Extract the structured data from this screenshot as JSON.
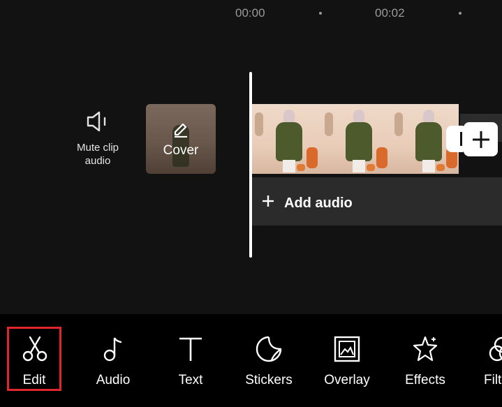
{
  "timeline": {
    "ruler": {
      "t0": "00:00",
      "t1": "00:02"
    },
    "mute_clip": {
      "label_line1": "Mute clip",
      "label_line2": "audio"
    },
    "cover": {
      "label": "Cover"
    },
    "add_audio": {
      "label": "Add audio"
    }
  },
  "toolbar": {
    "tools": [
      {
        "label": "Edit",
        "icon": "scissors-icon",
        "selected": true
      },
      {
        "label": "Audio",
        "icon": "music-note-icon"
      },
      {
        "label": "Text",
        "icon": "text-icon"
      },
      {
        "label": "Stickers",
        "icon": "sticker-icon"
      },
      {
        "label": "Overlay",
        "icon": "overlay-icon"
      },
      {
        "label": "Effects",
        "icon": "effects-star-icon"
      },
      {
        "label": "Filt",
        "icon": "filters-icon"
      }
    ]
  },
  "colors": {
    "background": "#121212",
    "toolbar_background": "#000000",
    "selection_outline": "#e0262c"
  }
}
